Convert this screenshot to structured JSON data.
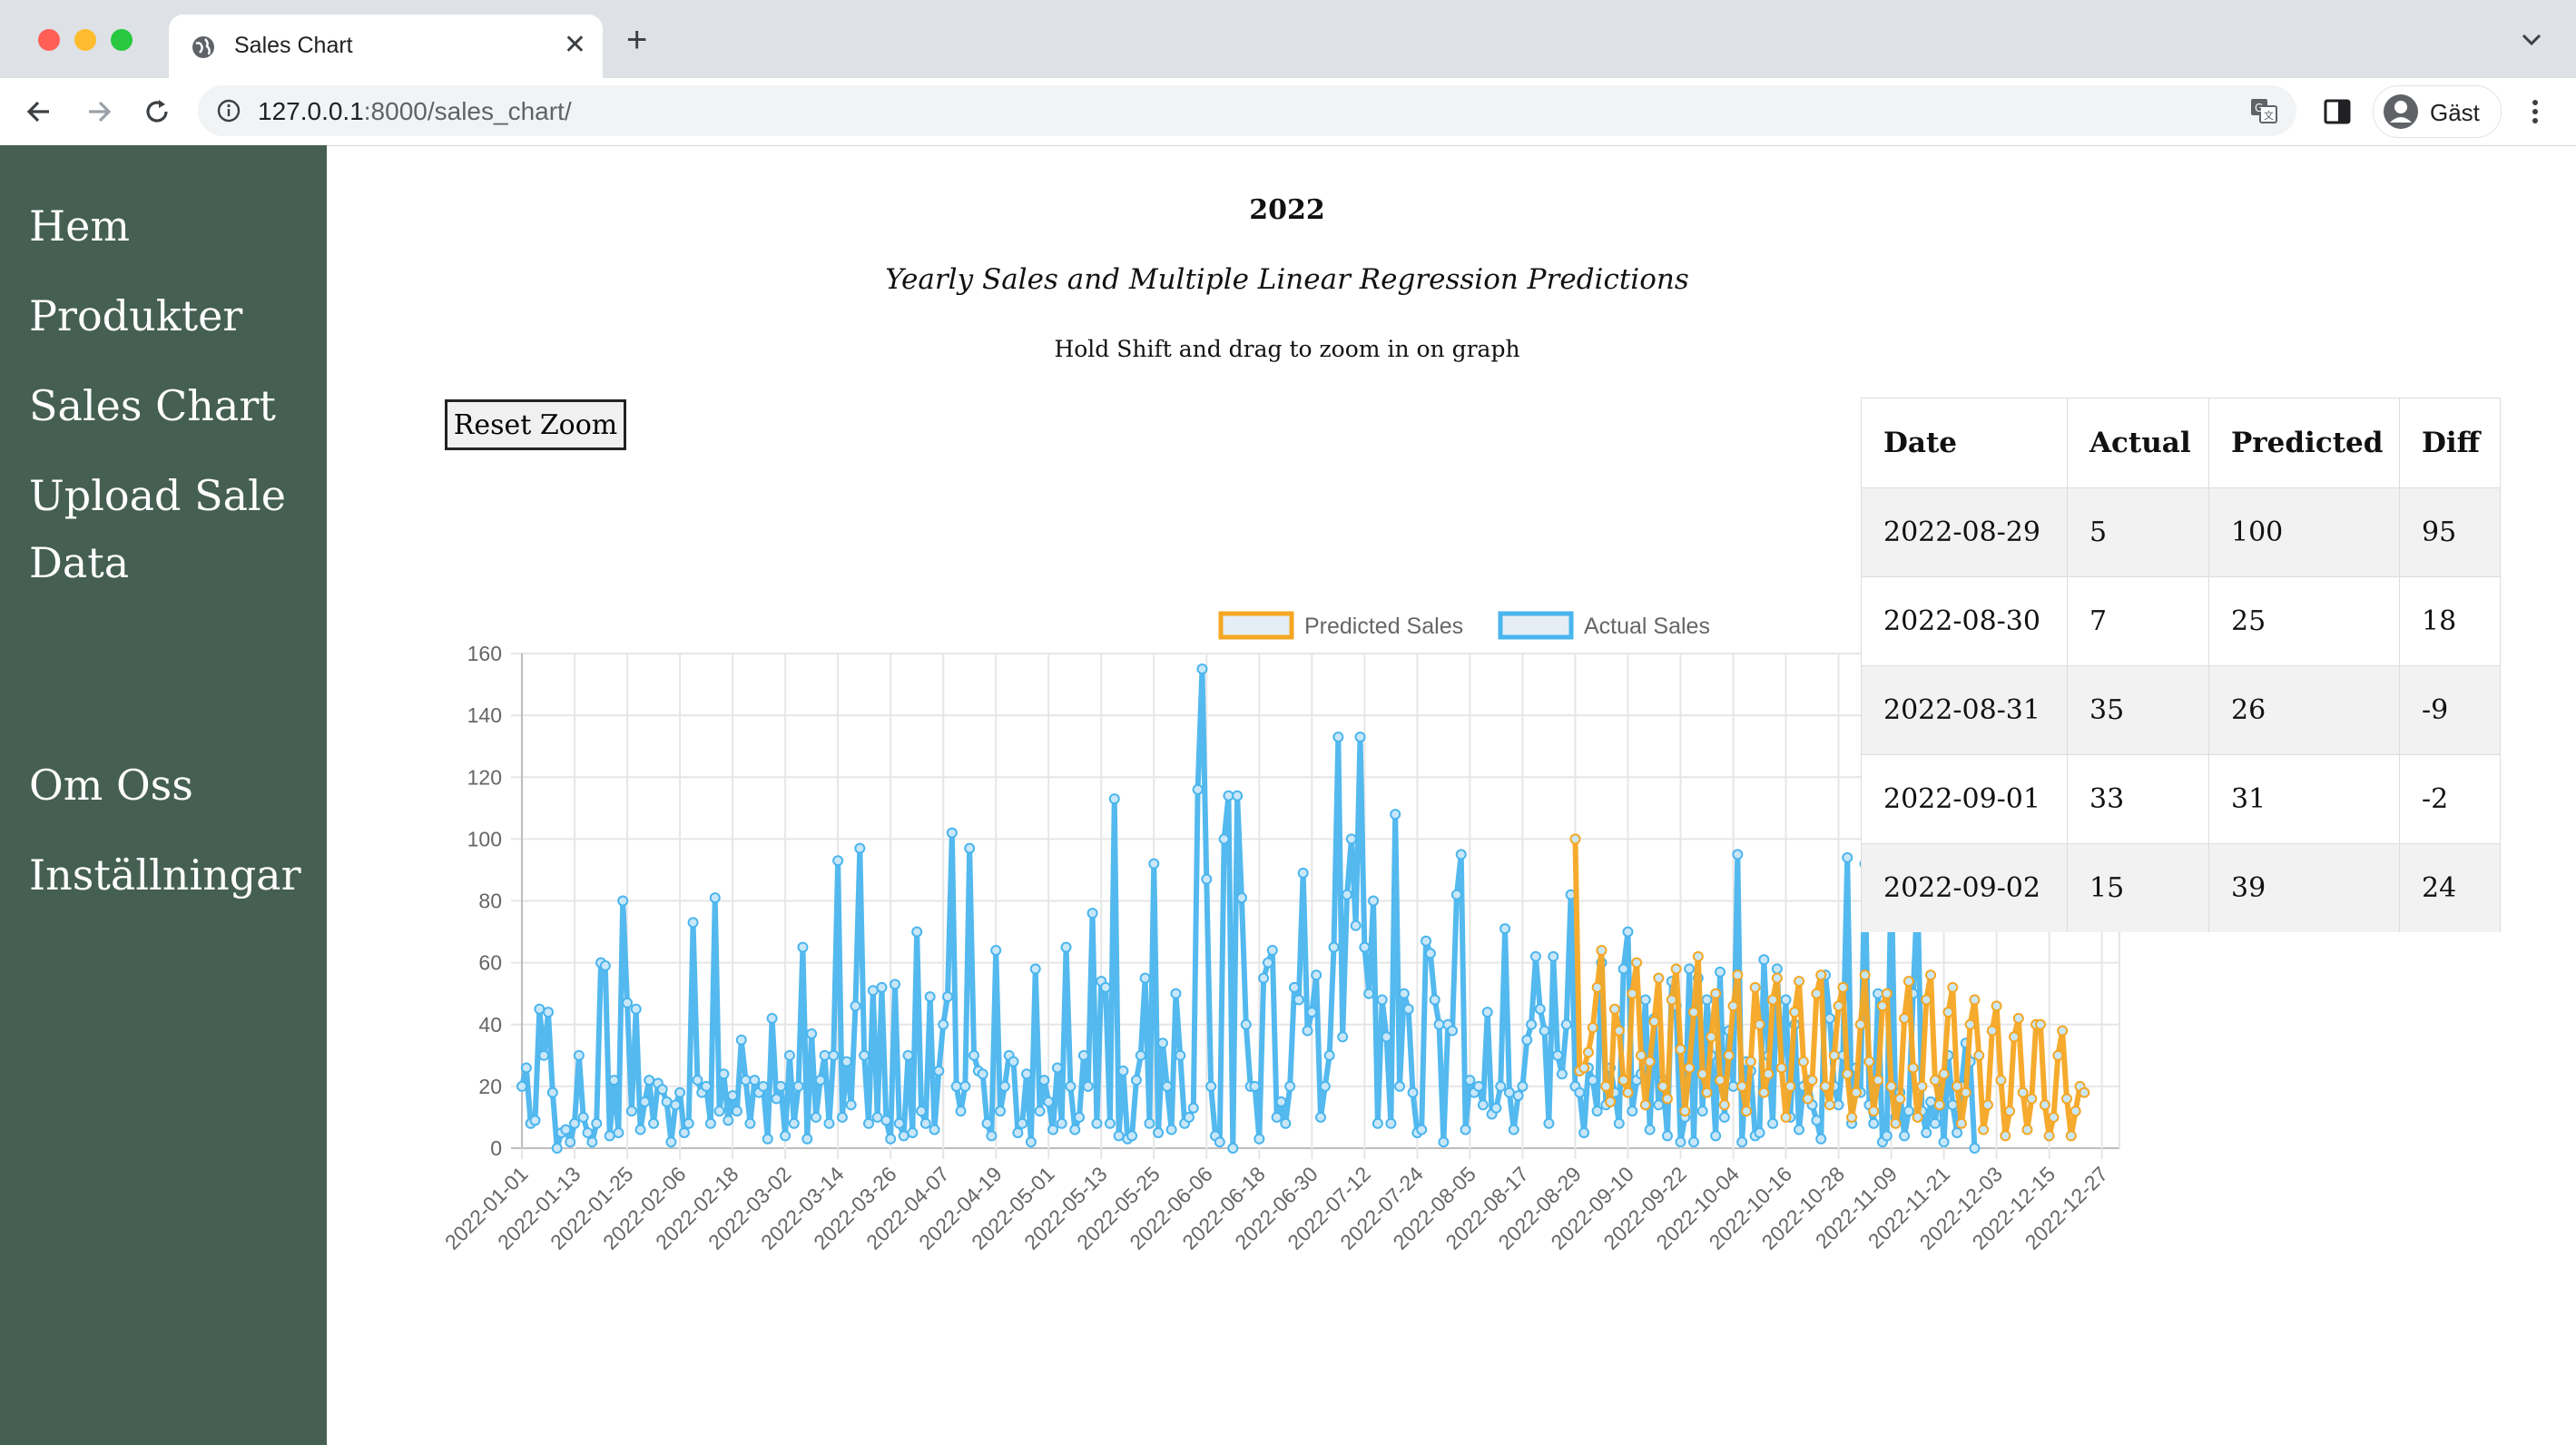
{
  "browser": {
    "tab_title": "Sales Chart",
    "url_host": "127.0.0.1",
    "url_rest": ":8000/sales_chart/",
    "profile_label": "Gäst"
  },
  "sidebar": {
    "items": [
      {
        "label": "Hem"
      },
      {
        "label": "Produkter"
      },
      {
        "label": "Sales Chart"
      },
      {
        "label": "Upload Sale Data"
      },
      {
        "label": "Om Oss"
      },
      {
        "label": "Inställningar"
      }
    ]
  },
  "page": {
    "year": "2022",
    "subtitle": "Yearly Sales and Multiple Linear Regression Predictions",
    "hint": "Hold Shift and drag to zoom in on graph",
    "reset_zoom": "Reset Zoom"
  },
  "chart_data": {
    "type": "line",
    "legend_position": "top",
    "ylim": [
      0,
      160
    ],
    "yticks": [
      0,
      20,
      40,
      60,
      80,
      100,
      120,
      140,
      160
    ],
    "grid": true,
    "x_tick_labels": [
      "2022-01-01",
      "2022-01-13",
      "2022-01-25",
      "2022-02-06",
      "2022-02-18",
      "2022-03-02",
      "2022-03-14",
      "2022-03-26",
      "2022-04-07",
      "2022-04-19",
      "2022-05-01",
      "2022-05-13",
      "2022-05-25",
      "2022-06-06",
      "2022-06-18",
      "2022-06-30",
      "2022-07-12",
      "2022-07-24",
      "2022-08-05",
      "2022-08-17",
      "2022-08-29",
      "2022-09-10",
      "2022-09-22",
      "2022-10-04",
      "2022-10-16",
      "2022-10-28",
      "2022-11-09",
      "2022-11-21",
      "2022-12-03",
      "2022-12-15",
      "2022-12-27"
    ],
    "x_start": "2022-01-01",
    "x_end": "2022-12-31",
    "series": [
      {
        "name": "Predicted Sales",
        "color": "#f5a623",
        "start": "2022-08-29",
        "values": [
          100,
          25,
          26,
          31,
          39,
          52,
          64,
          20,
          15,
          45,
          38,
          22,
          18,
          50,
          60,
          30,
          14,
          28,
          41,
          55,
          20,
          16,
          48,
          58,
          32,
          12,
          26,
          44,
          62,
          24,
          18,
          36,
          50,
          22,
          14,
          30,
          46,
          56,
          20,
          12,
          28,
          52,
          40,
          18,
          24,
          48,
          55,
          26,
          10,
          20,
          44,
          54,
          28,
          16,
          22,
          50,
          56,
          20,
          14,
          30,
          46,
          52,
          24,
          10,
          18,
          40,
          56,
          28,
          12,
          22,
          46,
          50,
          20,
          8,
          16,
          42,
          54,
          26,
          10,
          20,
          48,
          56,
          22,
          14,
          24,
          44,
          52,
          20,
          8,
          18,
          40,
          48,
          30,
          6,
          14,
          38,
          46,
          22,
          4,
          12,
          36,
          42,
          18,
          6,
          16,
          40,
          40,
          14,
          4,
          10,
          30,
          38,
          16,
          4,
          12,
          20,
          18
        ]
      },
      {
        "name": "Actual Sales",
        "color": "#4ab5ee",
        "start": "2022-01-01",
        "values": [
          20,
          26,
          8,
          9,
          45,
          30,
          44,
          18,
          0,
          5,
          6,
          2,
          8,
          30,
          10,
          5,
          2,
          8,
          60,
          59,
          4,
          22,
          5,
          80,
          47,
          12,
          45,
          6,
          15,
          22,
          8,
          21,
          19,
          15,
          2,
          14,
          18,
          5,
          8,
          73,
          22,
          18,
          20,
          8,
          81,
          12,
          24,
          9,
          17,
          12,
          35,
          22,
          8,
          22,
          18,
          20,
          3,
          42,
          16,
          20,
          4,
          30,
          8,
          20,
          65,
          3,
          37,
          10,
          22,
          30,
          8,
          30,
          93,
          10,
          28,
          14,
          46,
          97,
          30,
          8,
          51,
          10,
          52,
          9,
          3,
          53,
          8,
          4,
          30,
          5,
          70,
          12,
          8,
          49,
          6,
          25,
          40,
          49,
          102,
          20,
          12,
          20,
          97,
          30,
          25,
          24,
          8,
          4,
          64,
          12,
          20,
          30,
          28,
          5,
          8,
          24,
          2,
          58,
          12,
          22,
          15,
          6,
          26,
          8,
          65,
          20,
          6,
          10,
          30,
          20,
          76,
          8,
          54,
          52,
          8,
          113,
          4,
          25,
          3,
          4,
          22,
          30,
          55,
          8,
          92,
          5,
          34,
          20,
          6,
          50,
          30,
          8,
          10,
          13,
          116,
          155,
          87,
          20,
          4,
          2,
          100,
          114,
          0,
          114,
          81,
          40,
          20,
          20,
          3,
          55,
          60,
          64,
          10,
          15,
          8,
          20,
          52,
          48,
          89,
          38,
          44,
          56,
          10,
          20,
          30,
          65,
          133,
          36,
          82,
          100,
          72,
          133,
          65,
          50,
          80,
          8,
          48,
          36,
          8,
          108,
          20,
          50,
          45,
          18,
          5,
          6,
          67,
          63,
          48,
          40,
          2,
          40,
          38,
          82,
          95,
          6,
          22,
          18,
          20,
          14,
          44,
          11,
          13,
          20,
          71,
          18,
          6,
          17,
          20,
          35,
          40,
          62,
          45,
          38,
          8,
          62,
          30,
          24,
          40,
          82,
          20,
          18,
          5,
          26,
          22,
          12,
          60,
          14,
          26,
          18,
          8,
          58,
          70,
          12,
          22,
          24,
          48,
          6,
          42,
          14,
          22,
          4,
          54,
          46,
          2,
          10,
          58,
          2,
          55,
          12,
          48,
          30,
          4,
          57,
          10,
          38,
          20,
          95,
          2,
          28,
          25,
          4,
          5,
          61,
          30,
          8,
          58,
          26,
          48,
          10,
          40,
          6,
          20,
          22,
          14,
          9,
          3,
          56,
          42,
          20,
          14,
          30,
          94,
          8,
          26,
          18,
          92,
          14,
          8,
          50,
          2,
          4,
          91,
          10,
          18,
          4,
          12,
          50,
          83,
          12,
          5,
          15,
          8,
          22,
          2,
          30,
          14,
          5,
          20,
          34,
          28,
          0
        ]
      }
    ]
  },
  "table": {
    "headers": [
      "Date",
      "Actual",
      "Predicted",
      "Diff"
    ],
    "rows": [
      [
        "2022-08-29",
        "5",
        "100",
        "95"
      ],
      [
        "2022-08-30",
        "7",
        "25",
        "18"
      ],
      [
        "2022-08-31",
        "35",
        "26",
        "-9"
      ],
      [
        "2022-09-01",
        "33",
        "31",
        "-2"
      ],
      [
        "2022-09-02",
        "15",
        "39",
        "24"
      ]
    ]
  }
}
